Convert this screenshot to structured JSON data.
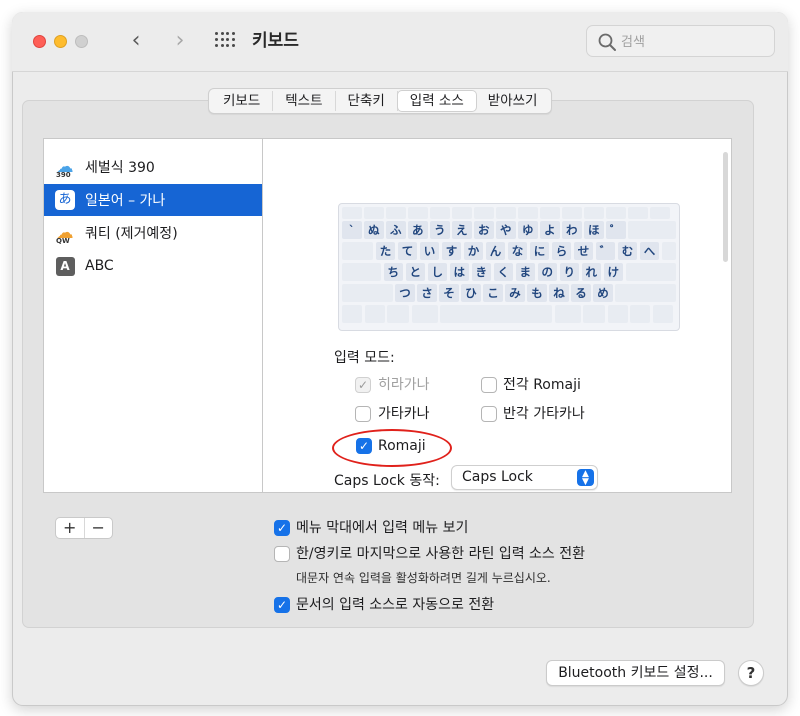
{
  "window": {
    "title": "키보드"
  },
  "search": {
    "placeholder": "검색"
  },
  "tabs": [
    "키보드",
    "텍스트",
    "단축키",
    "입력 소스",
    "받아쓰기"
  ],
  "sources": [
    {
      "label": "세벌식 390",
      "icon": "cloud-blue-icon",
      "tag": "390"
    },
    {
      "label": "일본어 – 가나",
      "icon": "hiragana-a-icon",
      "glyph": "あ",
      "selected": true
    },
    {
      "label": "쿼티 (제거예정)",
      "icon": "cloud-orange-icon",
      "tag": "QW"
    },
    {
      "label": "ABC",
      "icon": "abc-icon",
      "glyph": "A"
    }
  ],
  "keyboard": {
    "rows": [
      [
        "`",
        "ぬ",
        "ふ",
        "あ",
        "う",
        "え",
        "お",
        "や",
        "ゆ",
        "よ",
        "わ",
        "ほ",
        "゜"
      ],
      [
        "た",
        "て",
        "い",
        "す",
        "か",
        "ん",
        "な",
        "に",
        "ら",
        "せ",
        "゛",
        "む",
        "へ"
      ],
      [
        "ち",
        "と",
        "し",
        "は",
        "き",
        "く",
        "ま",
        "の",
        "り",
        "れ",
        "け"
      ],
      [
        "つ",
        "さ",
        "そ",
        "ひ",
        "こ",
        "み",
        "も",
        "ね",
        "る",
        "め"
      ]
    ]
  },
  "input_mode": {
    "label": "입력 모드:",
    "options": [
      {
        "label": "히라가나",
        "checked": true,
        "disabled": true
      },
      {
        "label": "전각 Romaji",
        "checked": false
      },
      {
        "label": "가타카나",
        "checked": false
      },
      {
        "label": "반각 가타카나",
        "checked": false
      },
      {
        "label": "Romaji",
        "checked": true
      }
    ]
  },
  "caps_lock": {
    "label": "Caps Lock 동작:",
    "value": "Caps Lock"
  },
  "buttons": {
    "add": "+",
    "remove": "−",
    "bluetooth": "Bluetooth 키보드 설정...",
    "help": "?"
  },
  "options": [
    {
      "label": "메뉴 막대에서 입력 메뉴 보기",
      "checked": true
    },
    {
      "label": "한/영키로 마지막으로 사용한 라틴 입력 소스 전환",
      "checked": false
    },
    {
      "label": "문서의 입력 소스로 자동으로 전환",
      "checked": true
    }
  ],
  "help_text": "대문자 연속 입력을 활성화하려면 길게 누르십시오.",
  "colors": {
    "accent": "#1672e8",
    "selection": "#1665d4",
    "annotation": "#e0211b"
  }
}
